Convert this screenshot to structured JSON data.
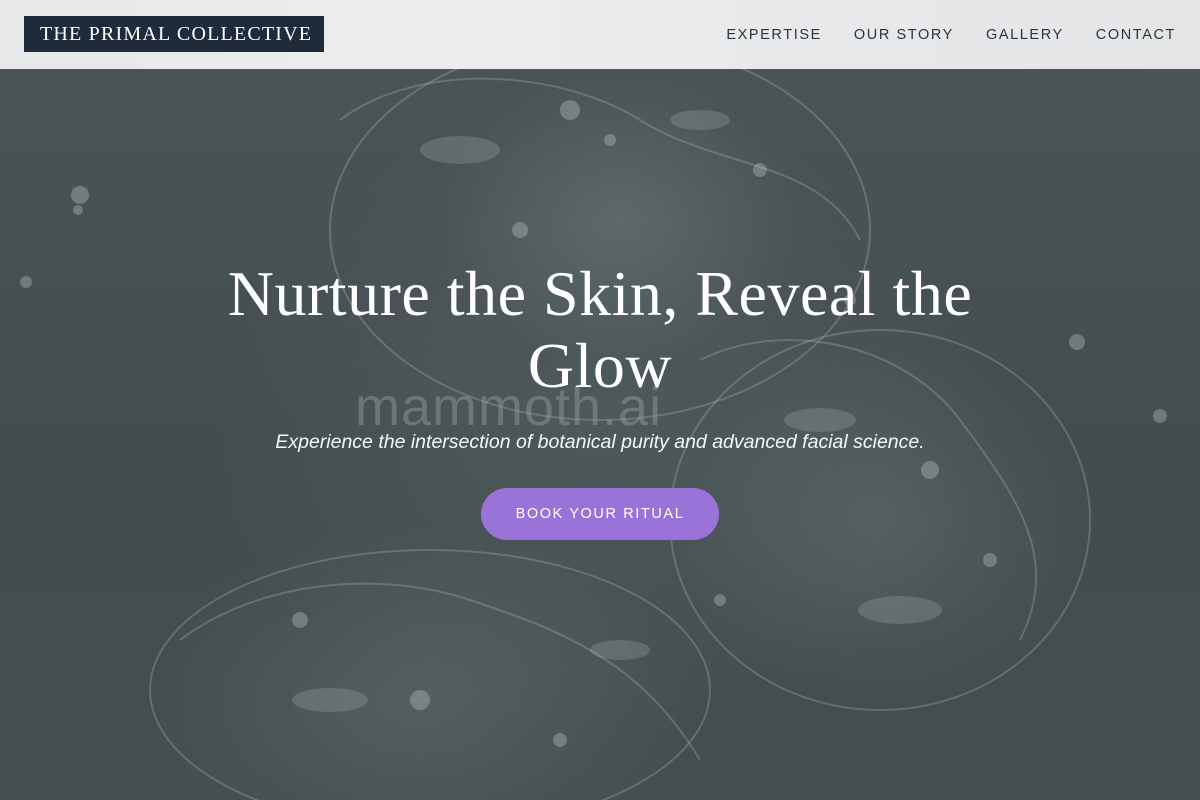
{
  "header": {
    "logo_text": "THE PRIMAL COLLECTIVE",
    "nav": [
      {
        "label": "EXPERTISE"
      },
      {
        "label": "OUR STORY"
      },
      {
        "label": "GALLERY"
      },
      {
        "label": "CONTACT"
      }
    ]
  },
  "hero": {
    "title_line1": "Nurture the Skin, Reveal the",
    "title_line2": "Glow",
    "watermark": "mammoth.ai",
    "subtitle": "Experience the intersection of botanical purity and advanced facial science.",
    "cta_label": "BOOK YOUR RITUAL",
    "background_image": "water-splash"
  },
  "colors": {
    "logo_bg": "#1f2a3a",
    "cta_bg": "#9a73d9",
    "header_bg": "#e9eaeb",
    "hero_bg": "#4b5558"
  }
}
